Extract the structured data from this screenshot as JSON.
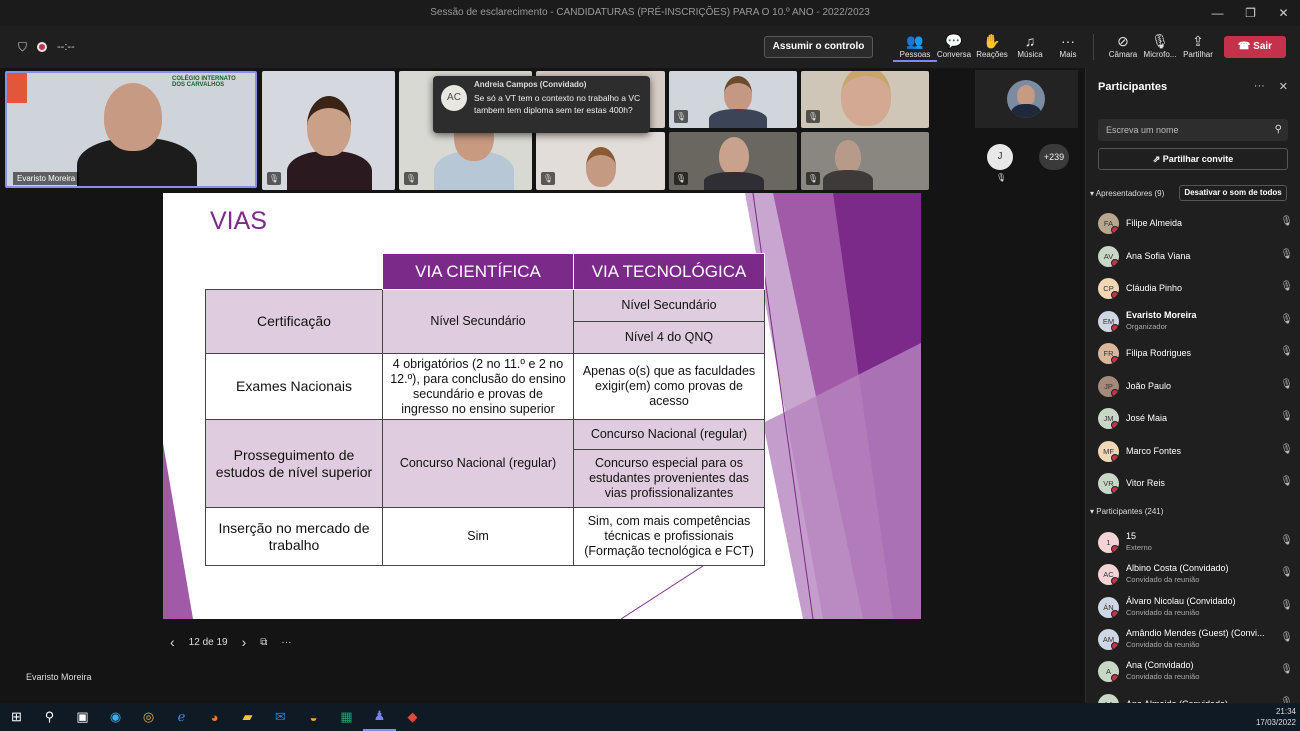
{
  "window": {
    "title": "Sessão de esclarecimento - CANDIDATURAS (PRÉ-INSCRIÇÕES) PARA O 10.º ANO - 2022/2023",
    "controls": [
      "—",
      "❐",
      "✕"
    ]
  },
  "toolbar": {
    "timer": "--:--",
    "control_label": "Assumir o controlo",
    "buttons": [
      {
        "name": "pessoas",
        "label": "Pessoas",
        "icon": "people-icon"
      },
      {
        "name": "conversa",
        "label": "Conversa",
        "icon": "chat-icon"
      },
      {
        "name": "reacoes",
        "label": "Reações",
        "icon": "reactions-icon"
      },
      {
        "name": "musica",
        "label": "Música",
        "icon": "music-icon"
      },
      {
        "name": "mais",
        "label": "Mais",
        "icon": "more-icon"
      },
      {
        "name": "camera",
        "label": "Câmara",
        "icon": "camera-off-icon"
      },
      {
        "name": "microfone",
        "label": "Microfo...",
        "icon": "mic-off-icon"
      },
      {
        "name": "partilhar",
        "label": "Partilhar",
        "icon": "share-icon"
      }
    ],
    "leave_label": "Sair"
  },
  "video": {
    "main_name": "Evaristo Moreira",
    "logo_text": "COLÉGIO INTERNATO DOS CARVALHOS",
    "overflow_count": "+239",
    "small_avatar": "J"
  },
  "toast": {
    "initials": "AC",
    "sender": "Andreia Campos (Convidado)",
    "message": "Se só a VT tem o contexto no trabalho a VC tambem tem diploma sem ter estas 400h?"
  },
  "slide": {
    "title": "VIAS",
    "headers": [
      "VIA CIENTÍFICA",
      "VIA TECNOLÓGICA"
    ],
    "rows": {
      "cert_label": "Certificação",
      "cert_sci": "Nível Secundário",
      "cert_tec_1": "Nível Secundário",
      "cert_tec_2": "Nível 4 do QNQ",
      "exam_label": "Exames Nacionais",
      "exam_sci": "4 obrigatórios (2 no 11.º e 2 no 12.º), para conclusão do ensino secundário e provas de ingresso no ensino superior",
      "exam_tec": "Apenas o(s) que as faculdades exigir(em) como provas de acesso",
      "pros_label": "Prosseguimento de estudos de nível superior",
      "pros_sci": "Concurso Nacional (regular)",
      "pros_tec_1": "Concurso Nacional (regular)",
      "pros_tec_2": "Concurso especial para os estudantes provenientes das vias profissionalizantes",
      "ins_label": "Inserção no mercado de trabalho",
      "ins_sci": "Sim",
      "ins_tec": "Sim, com mais competências técnicas e profissionais (Formação tecnológica e FCT)"
    },
    "page_indicator": "12 de 19",
    "presenter": "Evaristo Moreira"
  },
  "panel": {
    "title": "Participantes",
    "search_placeholder": "Escreva um nome",
    "invite_label": "Partilhar convite",
    "presenters_label": "Apresentadores (9)",
    "mute_all_label": "Desativar o som de todos",
    "participants_label": "Participantes (241)",
    "presenters": [
      {
        "initials": "FA",
        "name": "Filipe Almeida",
        "sub": "",
        "color": "#b9a68f"
      },
      {
        "initials": "AV",
        "name": "Ana Sofia Viana",
        "sub": "",
        "color": "#c9d7c6"
      },
      {
        "initials": "CP",
        "name": "Cláudia Pinho",
        "sub": "",
        "color": "#f1d8b5"
      },
      {
        "initials": "EM",
        "name": "Evaristo Moreira",
        "sub": "Organizador",
        "color": "#cfd6e4"
      },
      {
        "initials": "FR",
        "name": "Filipa Rodrigues",
        "sub": "",
        "color": "#d9b79d"
      },
      {
        "initials": "JP",
        "name": "João Paulo",
        "sub": "",
        "color": "#a48a7a"
      },
      {
        "initials": "JM",
        "name": "José Maia",
        "sub": "",
        "color": "#c9d7c6"
      },
      {
        "initials": "MF",
        "name": "Marco Fontes",
        "sub": "",
        "color": "#f1d8b5"
      },
      {
        "initials": "VR",
        "name": "Vitor Reis",
        "sub": "",
        "color": "#c9d7c6"
      }
    ],
    "attendees": [
      {
        "initials": "1",
        "name": "15",
        "sub": "Externo",
        "color": "#f2d4d6"
      },
      {
        "initials": "AC",
        "name": "Albino Costa (Convidado)",
        "sub": "Convidado da reunião",
        "color": "#f2d4d6"
      },
      {
        "initials": "ÁN",
        "name": "Álvaro Nicolau (Convidado)",
        "sub": "Convidado da reunião",
        "color": "#cfd6e4"
      },
      {
        "initials": "AM",
        "name": "Amândio Mendes (Guest) (Convi...",
        "sub": "Convidado da reunião",
        "color": "#cfd6e4"
      },
      {
        "initials": "A",
        "name": "Ana (Convidado)",
        "sub": "Convidado da reunião",
        "color": "#c9d7c6"
      },
      {
        "initials": "AA",
        "name": "Ana Almeida (Convidado)",
        "sub": "",
        "color": "#c9d7c6"
      }
    ]
  },
  "taskbar": {
    "time": "21:34",
    "date": "17/03/2022"
  }
}
